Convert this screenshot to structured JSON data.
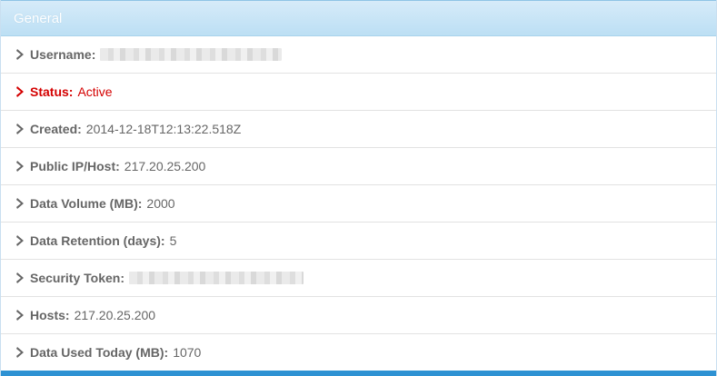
{
  "panel": {
    "title": "General",
    "colors": {
      "header_bg": "#bcdff4",
      "status_red": "#d40000",
      "bottom_bar": "#2e92d3"
    }
  },
  "rows": [
    {
      "label": "Username:",
      "value": "",
      "redacted": true
    },
    {
      "label": "Status:",
      "value": "Active"
    },
    {
      "label": "Created:",
      "value": "2014-12-18T12:13:22.518Z"
    },
    {
      "label": "Public IP/Host:",
      "value": "217.20.25.200"
    },
    {
      "label": "Data Volume (MB):",
      "value": "2000"
    },
    {
      "label": "Data Retention (days):",
      "value": "5"
    },
    {
      "label": "Security Token:",
      "value": "",
      "redacted": true
    },
    {
      "label": "Hosts:",
      "value": "217.20.25.200"
    },
    {
      "label": "Data Used Today (MB):",
      "value": "1070"
    }
  ],
  "icons": {
    "row_marker": "chevron-right-icon"
  }
}
